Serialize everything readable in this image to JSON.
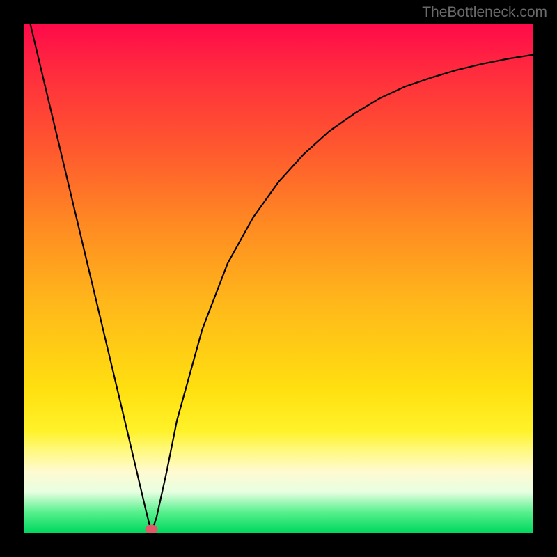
{
  "attribution": "TheBottleneck.com",
  "chart_data": {
    "type": "line",
    "title": "",
    "xlabel": "",
    "ylabel": "",
    "xlim": [
      0,
      100
    ],
    "ylim": [
      0,
      100
    ],
    "series": [
      {
        "name": "bottleneck-curve",
        "x": [
          0,
          5,
          10,
          15,
          20,
          22,
          24,
          25,
          26,
          28,
          30,
          35,
          40,
          45,
          50,
          55,
          60,
          65,
          70,
          75,
          80,
          85,
          90,
          95,
          100
        ],
        "y": [
          105,
          84,
          63,
          42,
          21,
          12.5,
          4,
          0,
          3,
          12,
          22,
          40,
          53,
          62,
          69,
          74.5,
          79,
          82.5,
          85.5,
          87.8,
          89.5,
          91,
          92.2,
          93.2,
          94
        ]
      }
    ],
    "marker": {
      "x": 25,
      "y": 0,
      "color": "#e15a6a"
    },
    "gradient_stops": [
      {
        "pos": 0,
        "color": "#ff0a4a"
      },
      {
        "pos": 25,
        "color": "#ff5a2e"
      },
      {
        "pos": 55,
        "color": "#ffb81a"
      },
      {
        "pos": 80,
        "color": "#fff22a"
      },
      {
        "pos": 92,
        "color": "#e7ffe1"
      },
      {
        "pos": 100,
        "color": "#00d85e"
      }
    ]
  }
}
